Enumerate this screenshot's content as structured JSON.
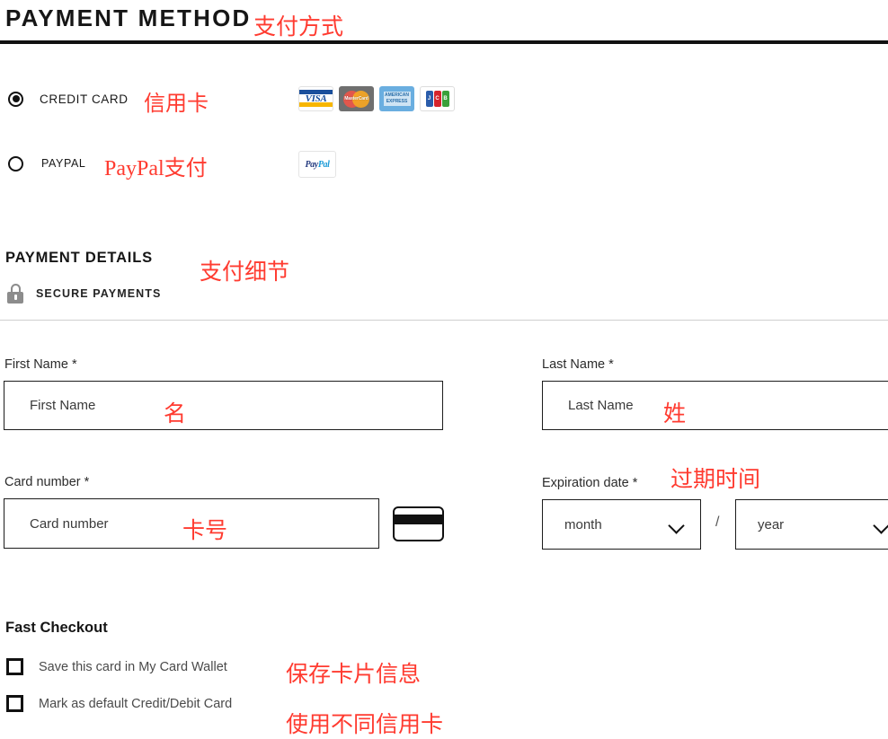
{
  "page": {
    "title": "PAYMENT METHOD",
    "title_annotation": "支付方式"
  },
  "payment_method": {
    "options": [
      {
        "label": "CREDIT CARD",
        "annotation": "信用卡",
        "selected": true,
        "brands": [
          {
            "name": "visa-logo",
            "text": "VISA"
          },
          {
            "name": "mastercard-logo",
            "text": "MasterCard"
          },
          {
            "name": "amex-logo",
            "line1": "AMERICAN",
            "line2": "EXPRESS"
          },
          {
            "name": "jcb-logo",
            "letters": [
              "J",
              "C",
              "B"
            ]
          }
        ]
      },
      {
        "label": "PAYPAL",
        "annotation": "PayPal支付",
        "selected": false,
        "brands": [
          {
            "name": "paypal-logo",
            "part_a": "Pay",
            "part_b": "Pal"
          }
        ]
      }
    ]
  },
  "payment_details": {
    "heading": "PAYMENT DETAILS",
    "heading_annotation": "支付细节",
    "secure_label": "SECURE PAYMENTS",
    "lock_icon": "lock-icon",
    "fields": {
      "first_name": {
        "label": "First Name",
        "required_mark": "*",
        "placeholder": "First Name",
        "value": "",
        "annotation": "名"
      },
      "last_name": {
        "label": "Last Name",
        "required_mark": "*",
        "placeholder": "Last Name",
        "value": "",
        "annotation": "姓"
      },
      "card_number": {
        "label": "Card number",
        "required_mark": "*",
        "placeholder": "Card number",
        "value": "",
        "annotation": "卡号",
        "icon": "credit-card-icon"
      },
      "expiration_date": {
        "label": "Expiration date",
        "required_mark": "*",
        "annotation": "过期时间",
        "separator": "/",
        "month": {
          "value": "month",
          "options": [
            "month"
          ]
        },
        "year": {
          "value": "year",
          "options": [
            "year"
          ]
        }
      }
    }
  },
  "fast_checkout": {
    "heading": "Fast Checkout",
    "checkboxes": [
      {
        "label": "Save this card in My Card Wallet",
        "checked": false,
        "annotation": "保存卡片信息"
      },
      {
        "label": "Mark as default Credit/Debit Card",
        "checked": false,
        "annotation": "使用不同信用卡"
      }
    ]
  },
  "colors": {
    "annotation_red": "#ff3b30",
    "text_dark": "#1a1a1a",
    "border_black": "#1c1c1c",
    "divider_light": "#cfcfcf",
    "visa_blue": "#1a4f9c",
    "visa_gold": "#f7b600",
    "mastercard_gray": "#6f6f6f",
    "amex_blue": "#6aaee0",
    "paypal_navy": "#253b80",
    "paypal_blue": "#1899d6",
    "lock_gray": "#8c8c8c"
  }
}
